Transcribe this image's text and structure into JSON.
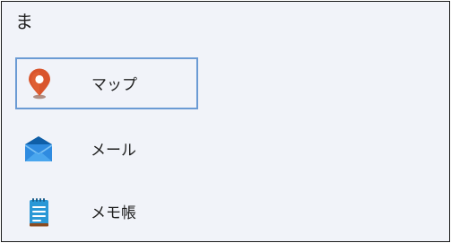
{
  "section": {
    "header_label": "ま"
  },
  "apps": [
    {
      "label": "マップ",
      "icon": "maps-pin-icon",
      "color": "#d9552d",
      "selected": true
    },
    {
      "label": "メール",
      "icon": "mail-envelope-icon",
      "color": "#1e78c8",
      "selected": false
    },
    {
      "label": "メモ帳",
      "icon": "notepad-icon",
      "color": "#1a88c9",
      "selected": false
    }
  ],
  "colors": {
    "panel_bg": "#f1f3f9",
    "selection_border": "#6b9bd4"
  }
}
